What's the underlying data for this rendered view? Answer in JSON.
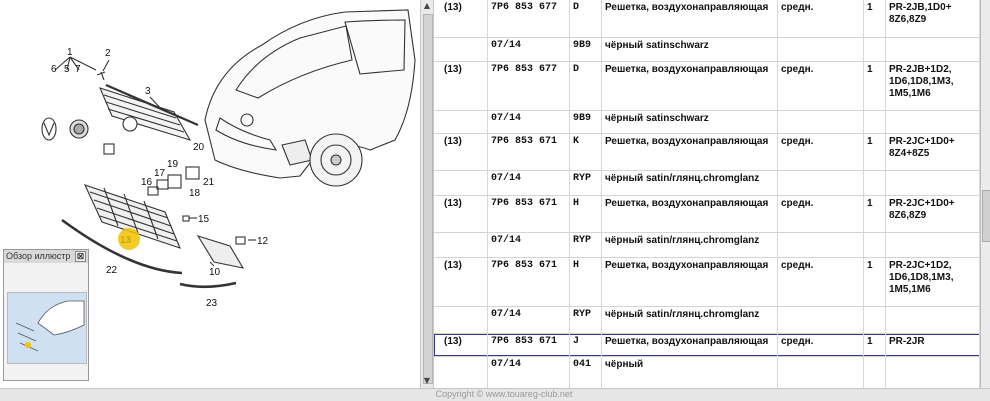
{
  "overview": {
    "title": "Обзор иллюстр",
    "close_glyph": "⊠"
  },
  "callouts": [
    "1",
    "2",
    "3",
    "5",
    "6",
    "7",
    "10",
    "12",
    "13",
    "15",
    "16",
    "17",
    "18",
    "19",
    "20",
    "21",
    "22",
    "23"
  ],
  "table": {
    "rows": [
      {
        "pos": "(13)",
        "partno": "7P6 853 677",
        "ver": "D",
        "name": "Решетка, воздухонаправляющая",
        "desc": "средн.",
        "qty": "1",
        "remark": "PR-2JB,1D0+\n8Z6,8Z9",
        "date": "07/14",
        "color": "9B9",
        "color_name": "чёрный satinschwarz"
      },
      {
        "pos": "(13)",
        "partno": "7P6 853 677",
        "ver": "D",
        "name": "Решетка, воздухонаправляющая",
        "desc": "средн.",
        "qty": "1",
        "remark": "PR-2JB+1D2,\n1D6,1D8,1M3,\n1M5,1M6",
        "date": "07/14",
        "color": "9B9",
        "color_name": "чёрный satinschwarz"
      },
      {
        "pos": "(13)",
        "partno": "7P6 853 671",
        "ver": "K",
        "name": "Решетка, воздухонаправляющая",
        "desc": "средн.",
        "qty": "1",
        "remark": "PR-2JC+1D0+\n8Z4+8Z5",
        "date": "07/14",
        "color": "RYP",
        "color_name": "чёрный satin/глянц.chromglanz"
      },
      {
        "pos": "(13)",
        "partno": "7P6 853 671",
        "ver": "H",
        "name": "Решетка, воздухонаправляющая",
        "desc": "средн.",
        "qty": "1",
        "remark": "PR-2JC+1D0+\n8Z6,8Z9",
        "date": "07/14",
        "color": "RYP",
        "color_name": "чёрный satin/глянц.chromglanz"
      },
      {
        "pos": "(13)",
        "partno": "7P6 853 671",
        "ver": "H",
        "name": "Решетка, воздухонаправляющая",
        "desc": "средн.",
        "qty": "1",
        "remark": "PR-2JC+1D2,\n1D6,1D8,1M3,\n1M5,1M6",
        "date": "07/14",
        "color": "RYP",
        "color_name": "чёрный satin/глянц.chromglanz"
      },
      {
        "pos": "(13)",
        "partno": "7P6 853 671",
        "ver": "J",
        "name": "Решетка, воздухонаправляющая",
        "desc": "средн.",
        "qty": "1",
        "remark": "PR-2JR",
        "date": "07/14",
        "color": "041",
        "color_name": "чёрный"
      }
    ]
  },
  "footer": {
    "copyright": "Copyright © www.touareg-club.net"
  }
}
